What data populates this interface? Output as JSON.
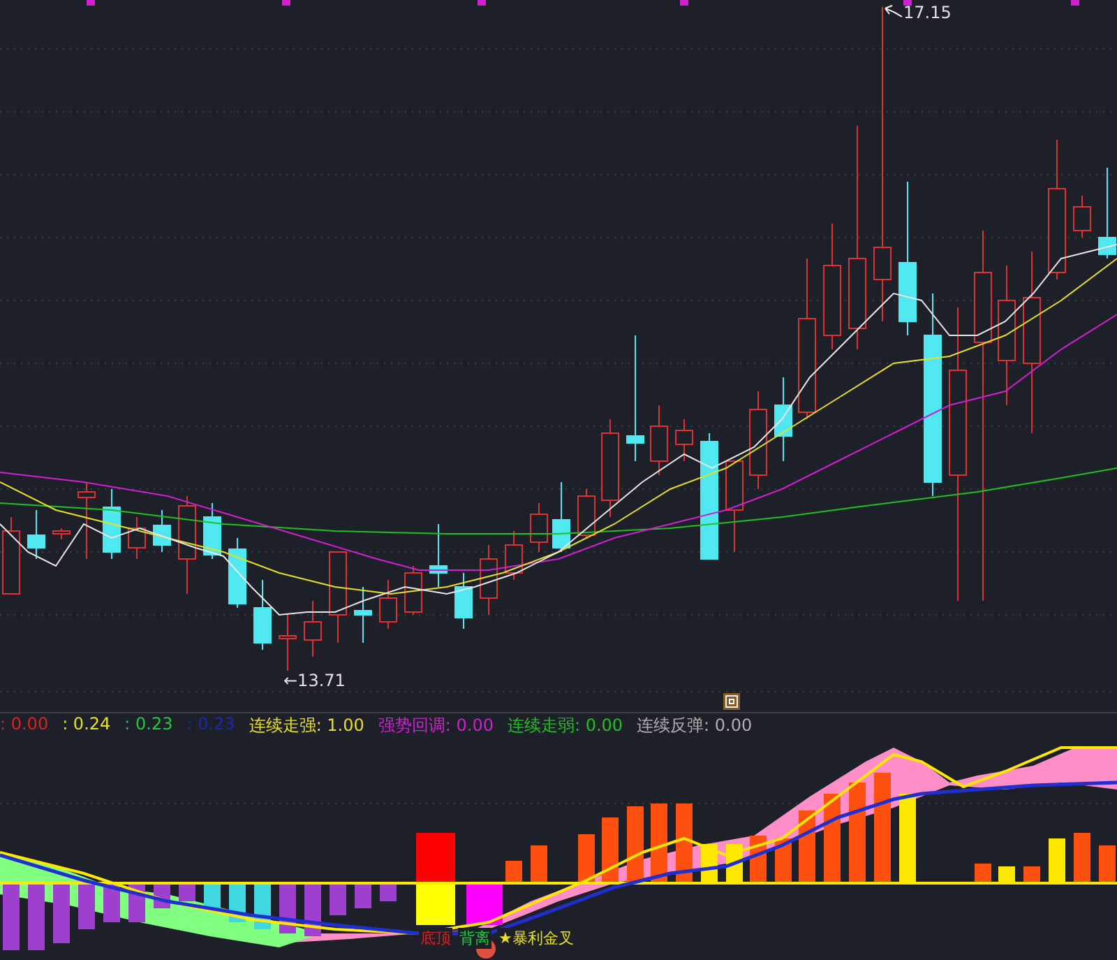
{
  "price_chart": {
    "high_label": "17.15",
    "low_label": "←13.71"
  },
  "indicator_legend": [
    {
      "text": ": 0.00",
      "color": "#e0201e"
    },
    {
      "text": ": 0.24",
      "color": "#e8e020"
    },
    {
      "text": ": 0.23",
      "color": "#20c840"
    },
    {
      "text": ": 0.23",
      "color": "#1a28b0"
    },
    {
      "text": "连续走强: 1.00",
      "color": "#e8e020"
    },
    {
      "text": "强势回调: 0.00",
      "color": "#d020d0"
    },
    {
      "text": "连续走弱: 0.00",
      "color": "#20c020"
    },
    {
      "text": "连续反弹: 0.00",
      "color": "#b0b0b0"
    }
  ],
  "signals": [
    {
      "text": "底顶",
      "color": "#e0201e"
    },
    {
      "text": "背离",
      "color": "#20c840"
    },
    {
      "text": "★暴利金叉",
      "color": "#e8e020"
    }
  ]
}
